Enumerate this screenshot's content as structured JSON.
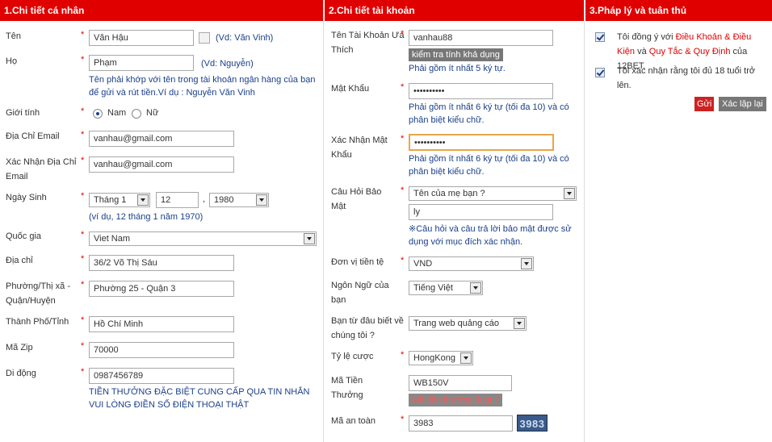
{
  "col1": {
    "header": "1.Chi tiết cá nhân",
    "ten": {
      "label": "Tên",
      "value": "Văn Hậu",
      "hint": "(Vd: Văn Vinh)"
    },
    "ho": {
      "label": "Họ",
      "value": "Phạm",
      "hint": "(Vd: Nguyễn)",
      "note": "Tên phải khớp với tên trong tài khoản ngân hàng của bạn để gửi và rút tiền.Ví dụ : Nguyễn Văn Vinh"
    },
    "gioi_tinh": {
      "label": "Giới tính",
      "male": "Nam",
      "female": "Nữ",
      "selected": "Nam"
    },
    "email": {
      "label": "Địa Chỉ Email",
      "value": "vanhau@gmail.com"
    },
    "email_confirm": {
      "label": "Xác Nhận Địa Chỉ Email",
      "value": "vanhau@gmail.com"
    },
    "ngay_sinh": {
      "label": "Ngày Sinh",
      "month": "Tháng 1",
      "day": "12",
      "sep": ",",
      "year": "1980",
      "hint": "(ví dụ, 12 tháng 1 năm 1970)"
    },
    "quoc_gia": {
      "label": "Quốc gia",
      "value": "Viet Nam"
    },
    "dia_chi": {
      "label": "Địa chỉ",
      "value": "36/2 Võ Thị Sáu"
    },
    "phuong": {
      "label": "Phường/Thị xã - Quận/Huyện",
      "value": "Phường 25  - Quận 3"
    },
    "thanh_pho": {
      "label": "Thành Phố/Tỉnh",
      "value": "Hồ Chí Minh"
    },
    "ma_zip": {
      "label": "Mã Zip",
      "value": "70000"
    },
    "di_dong": {
      "label": "Di động",
      "value": "0987456789",
      "note": "TIỀN THƯỞNG ĐẶC BIỆT CUNG CẤP QUA TIN NHẮN VUI LÒNG ĐIỀN SỐ ĐIỆN THOẠI THẬT"
    }
  },
  "col2": {
    "header": "2.Chi tiết tài khoản",
    "username": {
      "label": "Tên Tài Khoản Ưa Thích",
      "value": "vanhau88",
      "check_btn": "kiểm tra tính khả dụng",
      "hint": "Phải gồm ít nhất 5 ký tự."
    },
    "password": {
      "label": "Mật Khẩu",
      "value": "••••••••••",
      "hint": "Phải gồm ít nhất 6 ký tự (tối đa 10) và có phân biệt kiểu chữ."
    },
    "password_confirm": {
      "label": "Xác Nhận Mật Khẩu",
      "value": "••••••••••",
      "hint": "Phải gồm ít nhất 6 ký tự (tối đa 10) và có phân biệt kiểu chữ."
    },
    "security_q": {
      "label": "Câu Hỏi Bảo Mật",
      "question": "Tên của mẹ bạn ?",
      "answer": "ly",
      "hint": "※Câu hỏi và câu trả lời bảo mật được sử dụng với mục đích xác nhận."
    },
    "currency": {
      "label": "Đơn vị tiền tệ",
      "value": "VND"
    },
    "language": {
      "label": "Ngôn Ngữ của bạn",
      "value": "Tiếng Việt"
    },
    "source": {
      "label": "Bạn từ đâu biết về chúng tôi ?",
      "value": "Trang web quảng cáo"
    },
    "odds": {
      "label": "Tỷ lệ cược",
      "value": "HongKong"
    },
    "bonus": {
      "label": "Mã Tiền Thưởng",
      "value": "WB150V",
      "link": "Mã tiền thưởng là gì ?"
    },
    "captcha": {
      "label": "Mã an toàn",
      "value": "3983",
      "image_text": "3983"
    }
  },
  "col3": {
    "header": "3.Pháp lý và tuân thủ",
    "agree_prefix": "Tôi đồng ý với ",
    "agree_link1": "Điều Khoản & Điều Kiện",
    "agree_mid": " và ",
    "agree_link2": "Quy Tắc & Quy Định",
    "agree_suffix": " của 12BET.",
    "age_text": "Tôi xác nhận rằng tôi đủ 18 tuổi trở lên.",
    "submit": "Gửi",
    "reset": "Xác lập lại"
  },
  "required_mark": "*"
}
